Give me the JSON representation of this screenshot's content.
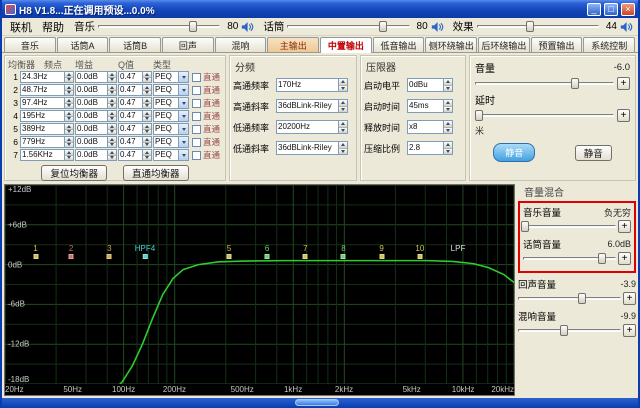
{
  "window": {
    "title": "H8 V1.8...正在调用预设...0.0%",
    "minimize": "_",
    "maximize": "□",
    "close": "×"
  },
  "menu": {
    "items": [
      {
        "label": "联机"
      },
      {
        "label": "帮助"
      }
    ]
  },
  "master_sliders": [
    {
      "name": "music",
      "label": "音乐",
      "value": "80",
      "percent": 78
    },
    {
      "name": "mic",
      "label": "话筒",
      "value": "80",
      "percent": 78
    },
    {
      "name": "effect",
      "label": "效果",
      "value": "44",
      "percent": 44
    }
  ],
  "tabs": [
    {
      "label": "音乐"
    },
    {
      "label": "话筒A"
    },
    {
      "label": "话筒B"
    },
    {
      "label": "回声"
    },
    {
      "label": "混响"
    },
    {
      "label": "主输出",
      "accent": true
    },
    {
      "label": "中置输出",
      "active": true
    },
    {
      "label": "低音输出"
    },
    {
      "label": "侧环绕输出"
    },
    {
      "label": "后环绕输出"
    },
    {
      "label": "预置输出"
    },
    {
      "label": "系统控制"
    }
  ],
  "equalizer": {
    "headers": {
      "band": "均衡器",
      "freq": "频点",
      "gain": "增益",
      "q": "Q值",
      "type": "类型"
    },
    "bypass_label": "直通",
    "rows": [
      {
        "num": "1",
        "freq": "24.3Hz",
        "gain": "0.0dB",
        "q": "0.47",
        "type": "PEQ"
      },
      {
        "num": "2",
        "freq": "48.7Hz",
        "gain": "0.0dB",
        "q": "0.47",
        "type": "PEQ"
      },
      {
        "num": "3",
        "freq": "97.4Hz",
        "gain": "0.0dB",
        "q": "0.47",
        "type": "PEQ"
      },
      {
        "num": "4",
        "freq": "195Hz",
        "gain": "0.0dB",
        "q": "0.47",
        "type": "PEQ"
      },
      {
        "num": "5",
        "freq": "389Hz",
        "gain": "0.0dB",
        "q": "0.47",
        "type": "PEQ"
      },
      {
        "num": "6",
        "freq": "779Hz",
        "gain": "0.0dB",
        "q": "0.47",
        "type": "PEQ"
      },
      {
        "num": "7",
        "freq": "1.56KHz",
        "gain": "0.0dB",
        "q": "0.47",
        "type": "PEQ"
      }
    ],
    "reset_button": "复位均衡器",
    "bypass_button": "直通均衡器"
  },
  "crossover": {
    "title": "分频",
    "fields": [
      {
        "label": "高通频率",
        "value": "170Hz"
      },
      {
        "label": "高通斜率",
        "value": "36dBLink-Riley"
      },
      {
        "label": "低通频率",
        "value": "20200Hz"
      },
      {
        "label": "低通斜率",
        "value": "36dBLink-Riley"
      }
    ]
  },
  "limiter": {
    "title": "压限器",
    "fields": [
      {
        "label": "启动电平",
        "value": "0dBu"
      },
      {
        "label": "启动时间",
        "value": "45ms"
      },
      {
        "label": "释放时间",
        "value": "x8"
      },
      {
        "label": "压缩比例",
        "value": "2.8"
      }
    ]
  },
  "output": {
    "volume_label": "音量",
    "volume_value": "-6.0",
    "volume_percent": 72,
    "delay_label": "延时",
    "delay_percent": 3,
    "delay_unit": "米",
    "mute_left": "静音",
    "mute_right": "静音",
    "plus": "+"
  },
  "mixer": {
    "title": "音量混合",
    "items": [
      {
        "label": "音乐音量",
        "value": "负无穷",
        "percent": 2,
        "highlight": true
      },
      {
        "label": "话筒音量",
        "value": "6.0dB",
        "percent": 85,
        "highlight": true
      },
      {
        "label": "回声音量",
        "value": "-3.9",
        "percent": 62
      },
      {
        "label": "混响音量",
        "value": "-9.9",
        "percent": 45
      }
    ]
  },
  "graph": {
    "type": "line",
    "y_labels": [
      "+12dB",
      "+6dB",
      "0dB",
      "-6dB",
      "-12dB",
      "-18dB"
    ],
    "x_labels": [
      {
        "text": "20Hz",
        "pos": 0
      },
      {
        "text": "50Hz",
        "pos": 13.3
      },
      {
        "text": "100Hz",
        "pos": 23.3
      },
      {
        "text": "200Hz",
        "pos": 33.3
      },
      {
        "text": "500Hz",
        "pos": 46.6
      },
      {
        "text": "1kHz",
        "pos": 56.6
      },
      {
        "text": "2kHz",
        "pos": 66.6
      },
      {
        "text": "5kHz",
        "pos": 79.9
      },
      {
        "text": "10kHz",
        "pos": 90
      },
      {
        "text": "20kHz",
        "pos": 100
      }
    ],
    "zero_line_percent": 38,
    "curve_color": "#2ecc2e",
    "curve": [
      [
        21,
        104
      ],
      [
        23,
        99
      ],
      [
        25,
        91
      ],
      [
        27,
        80
      ],
      [
        29,
        67
      ],
      [
        31,
        55
      ],
      [
        33,
        47
      ],
      [
        35,
        42.5
      ],
      [
        38,
        40
      ],
      [
        42,
        38.6
      ],
      [
        47,
        38.2
      ],
      [
        55,
        38
      ],
      [
        65,
        38
      ],
      [
        75,
        38
      ],
      [
        83,
        38
      ],
      [
        88,
        38.4
      ],
      [
        92,
        39.5
      ],
      [
        95,
        41.5
      ],
      [
        98,
        45
      ],
      [
        100,
        49
      ]
    ],
    "markers": [
      {
        "label": "1",
        "x": 6,
        "color": "#cfc24a",
        "box": true
      },
      {
        "label": "2",
        "x": 13,
        "color": "#d06a6a",
        "box": true
      },
      {
        "label": "3",
        "x": 20.5,
        "color": "#cfa84a",
        "box": true
      },
      {
        "label": "HPF4",
        "x": 27.5,
        "color": "#4ad0d0",
        "box": true
      },
      {
        "label": "5",
        "x": 44,
        "color": "#cfc24a",
        "box": true
      },
      {
        "label": "6",
        "x": 51.5,
        "color": "#6ad06a",
        "box": true
      },
      {
        "label": "7",
        "x": 59,
        "color": "#cfc24a",
        "box": true
      },
      {
        "label": "8",
        "x": 66.5,
        "color": "#6ad06a",
        "box": true
      },
      {
        "label": "9",
        "x": 74,
        "color": "#cfc24a",
        "box": true
      },
      {
        "label": "10",
        "x": 81.5,
        "color": "#cfc24a",
        "box": true
      },
      {
        "label": "LPF",
        "x": 89,
        "color": "#dddddd",
        "box": false
      }
    ]
  }
}
